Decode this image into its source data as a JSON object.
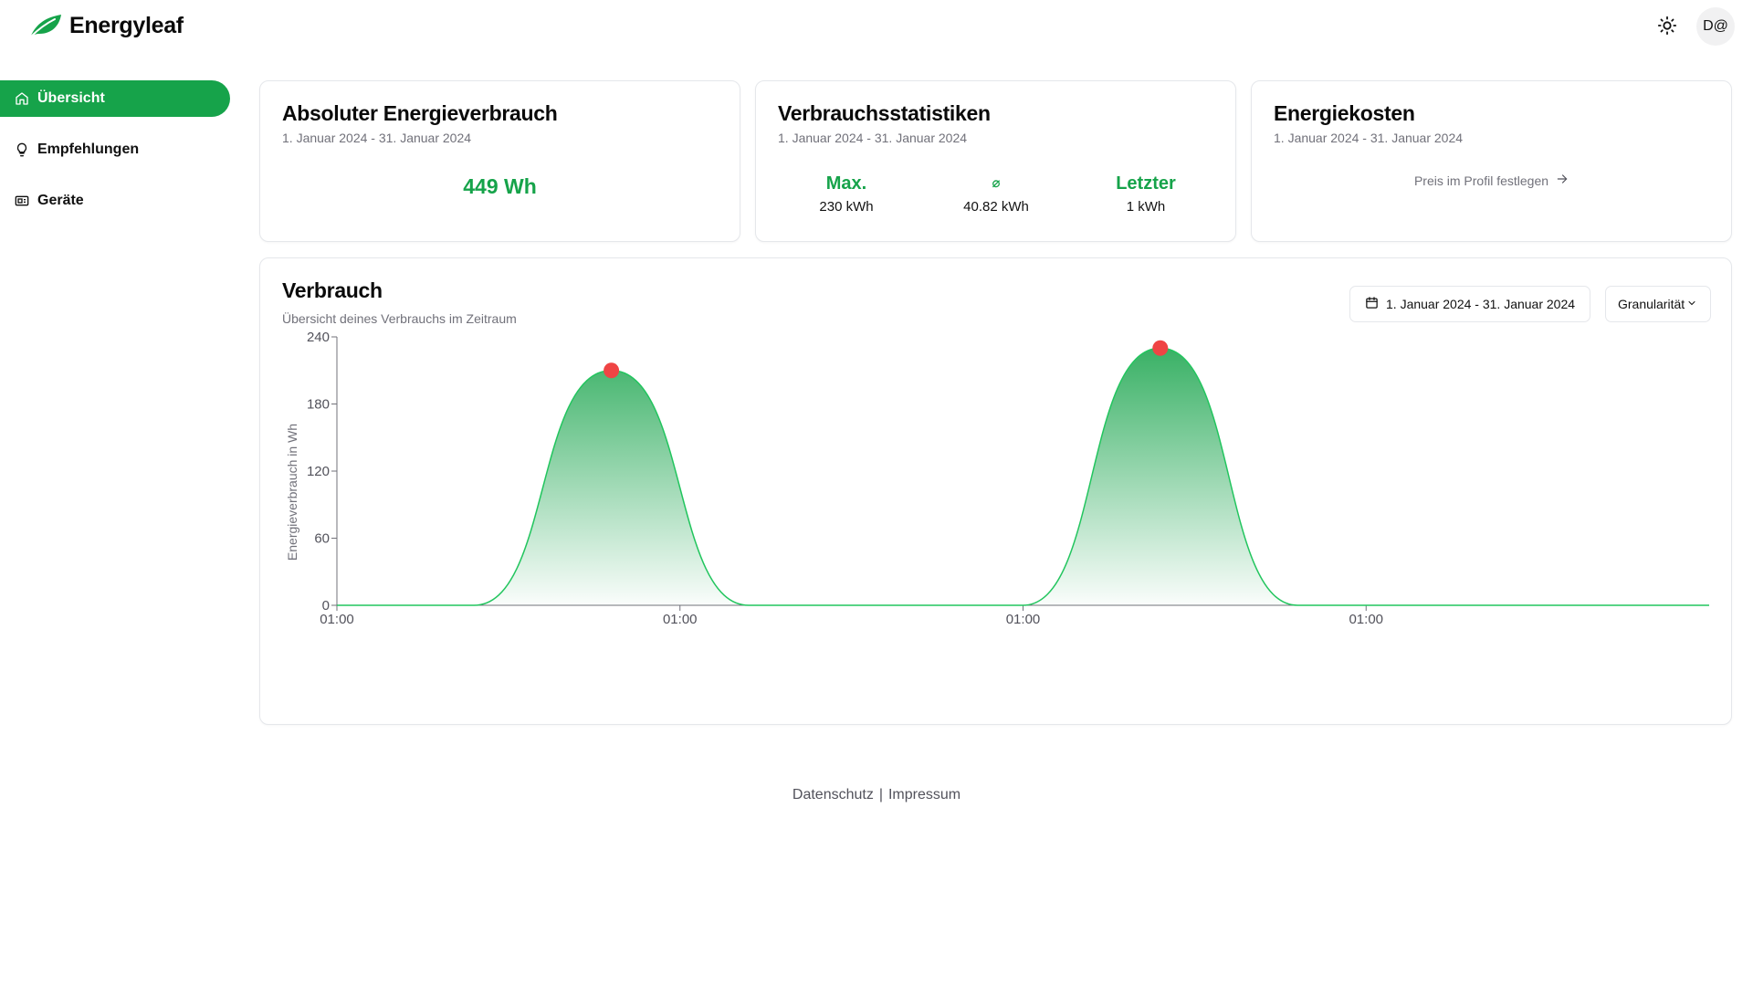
{
  "app": {
    "name": "Energyleaf"
  },
  "header": {
    "avatar_text": "D@",
    "theme_icon": "sun-icon"
  },
  "sidebar": {
    "items": [
      {
        "label": "Übersicht",
        "icon": "home-icon",
        "active": true
      },
      {
        "label": "Empfehlungen",
        "icon": "lightbulb-icon",
        "active": false
      },
      {
        "label": "Geräte",
        "icon": "device-icon",
        "active": false
      }
    ]
  },
  "cards": {
    "absolute": {
      "title": "Absoluter Energieverbrauch",
      "date_range": "1. Januar 2024 - 31. Januar 2024",
      "value": "449 Wh"
    },
    "stats": {
      "title": "Verbrauchsstatistiken",
      "date_range": "1. Januar 2024 - 31. Januar 2024",
      "max_label": "Max.",
      "max_value": "230 kWh",
      "avg_label": "⌀",
      "avg_value": "40.82 kWh",
      "last_label": "Letzter",
      "last_value": "1 kWh"
    },
    "costs": {
      "title": "Energiekosten",
      "date_range": "1. Januar 2024 - 31. Januar 2024",
      "link": "Preis im Profil festlegen"
    }
  },
  "consumption": {
    "title": "Verbrauch",
    "subtitle": "Übersicht deines Verbrauchs im Zeitraum",
    "date_button": "1. Januar 2024 - 31. Januar 2024",
    "granularity_button": "Granularität"
  },
  "footer": {
    "privacy": "Datenschutz",
    "separator": "|",
    "imprint": "Impressum"
  },
  "colors": {
    "accent": "#16a34a",
    "peak": "#ef4444",
    "line": "#22c55e"
  },
  "chart_data": {
    "type": "area",
    "ylabel": "Energieverbrauch in Wh",
    "xlabel": "",
    "ylim": [
      0,
      240
    ],
    "yticks": [
      0,
      60,
      120,
      180,
      240
    ],
    "xticks": [
      "01:00",
      "01:00",
      "01:00",
      "01:00"
    ],
    "xlim": [
      0,
      10
    ],
    "grid": false,
    "series": [
      {
        "values": [
          {
            "x": 0,
            "y": 0
          },
          {
            "x": 1,
            "y": 0
          },
          {
            "x": 2,
            "y": 210
          },
          {
            "x": 3,
            "y": 0
          },
          {
            "x": 5,
            "y": 0
          },
          {
            "x": 6,
            "y": 230
          },
          {
            "x": 7,
            "y": 0
          },
          {
            "x": 10,
            "y": 0
          }
        ],
        "peaks": [
          {
            "x": 2,
            "y": 210
          },
          {
            "x": 6,
            "y": 230
          }
        ]
      }
    ]
  }
}
